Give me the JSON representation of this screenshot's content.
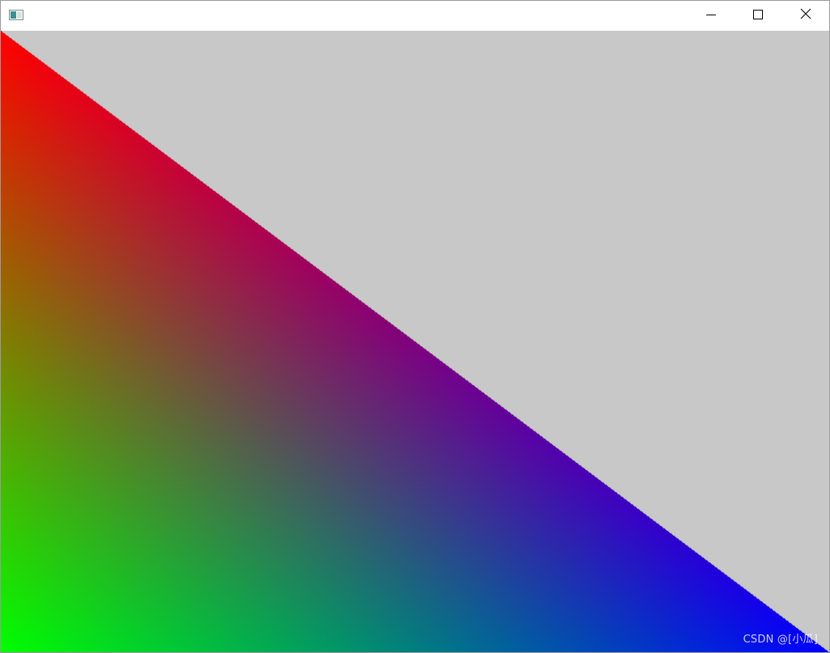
{
  "window": {
    "title": "",
    "icon": "window-app-icon",
    "controls": {
      "minimize_icon": "minimize-icon",
      "maximize_icon": "maximize-icon",
      "close_icon": "close-icon"
    }
  },
  "canvas": {
    "clear_color": "#c8c8c8",
    "triangle": {
      "vertex_colors": {
        "top_left": "#ff0000",
        "bottom_left": "#00ff00",
        "bottom_right": "#0000ff"
      }
    }
  },
  "watermark": {
    "text": "CSDN @[小瓜]"
  }
}
